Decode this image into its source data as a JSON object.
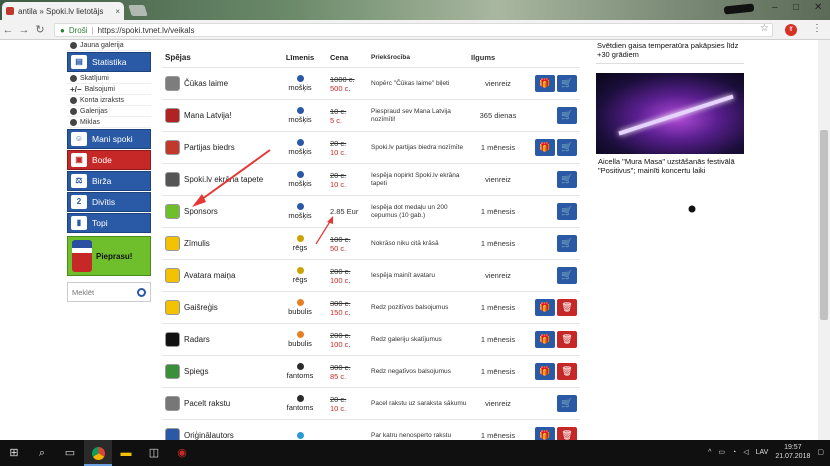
{
  "browser": {
    "tab_title": "antila » Spoki.lv lietotājs",
    "close_glyph": "×",
    "secure_label": "Droši",
    "url": "https://spoki.tvnet.lv/veikals",
    "ext_badge": "ff"
  },
  "sidebar": {
    "sub_items": [
      "Jauna galerija"
    ],
    "statistika": "Statistika",
    "sub_items2": [
      "Skatījumi",
      "Balsojumi",
      "Konta izraksts",
      "Galerijas",
      "Miklas"
    ],
    "mani_spoki": "Mani spoki",
    "bode": "Bode",
    "birza": "Birža",
    "divitis": "Divītis",
    "topi": "Topi",
    "pieprasu": "Pieprasu!",
    "search_placeholder": "Meklēt"
  },
  "table": {
    "headers": {
      "name": "Spējas",
      "level": "Līmenis",
      "price": "Cena",
      "desc": "Priekšrocība",
      "dur": "Ilgums"
    },
    "rows": [
      {
        "name": "Čūkas laime",
        "level": "mošķis",
        "old": "1000 c.",
        "new": "500 c.",
        "desc": "Nopērc \"Čūkas laime\" biļeti",
        "dur": "vienreiz",
        "gift": true,
        "trash": false,
        "icon_color": "#7d7d7d",
        "level_color": "#2a5aa6"
      },
      {
        "name": "Mana Latvija!",
        "level": "mošķis",
        "old": "10 c.",
        "new": "5 c.",
        "desc": "Piespraud sev Mana Latvija nozīmīti!",
        "dur": "365 dienas",
        "gift": false,
        "trash": false,
        "icon_color": "#b22222",
        "level_color": "#2a5aa6"
      },
      {
        "name": "Partijas biedrs",
        "level": "mošķis",
        "old": "20 c.",
        "new": "10 c.",
        "desc": "Spoki.lv partijas biedra nozīmīte",
        "dur": "1 mēnesis",
        "gift": true,
        "trash": false,
        "icon_color": "#c0392b",
        "level_color": "#2a5aa6"
      },
      {
        "name": "Spoki.lv ekrāna tapete",
        "level": "mošķis",
        "old": "20 c.",
        "new": "10 c.",
        "desc": "Iespēja nopirkt Spoki.lv ekrāna tapeti",
        "dur": "vienreiz",
        "gift": false,
        "trash": false,
        "icon_color": "#555",
        "level_color": "#2a5aa6"
      },
      {
        "name": "Sponsors",
        "level": "mošķis",
        "old": "",
        "new": "",
        "cur": "2.85 Eur",
        "desc": "Iespēja dot medaļu un 200 cepumus (10 gab.)",
        "dur": "1 mēnesis",
        "gift": false,
        "trash": false,
        "icon_color": "#6fbe2c",
        "level_color": "#2a5aa6"
      },
      {
        "name": "Zīmulis",
        "level": "rēgs",
        "old": "100 c.",
        "new": "50 c.",
        "desc": "Nokrāso niku citā krāsā",
        "dur": "1 mēnesis",
        "gift": false,
        "trash": false,
        "icon_color": "#f2c200",
        "level_color": "#c9a400"
      },
      {
        "name": "Avatara maiņa",
        "level": "rēgs",
        "old": "200 c.",
        "new": "100 c.",
        "desc": "Iespēja mainīt avataru",
        "dur": "vienreiz",
        "gift": false,
        "trash": false,
        "icon_color": "#f2c200",
        "level_color": "#c9a400"
      },
      {
        "name": "Gaišreģis",
        "level": "bubulis",
        "old": "300 c.",
        "new": "150 c.",
        "desc": "Redz pozitīvos balsojumus",
        "dur": "1 mēnesis",
        "gift": true,
        "trash": true,
        "icon_color": "#f2c200",
        "level_color": "#e67e22"
      },
      {
        "name": "Radars",
        "level": "bubulis",
        "old": "200 c.",
        "new": "100 c.",
        "desc": "Redz galeriju skatījumus",
        "dur": "1 mēnesis",
        "gift": true,
        "trash": true,
        "icon_color": "#111",
        "level_color": "#e67e22"
      },
      {
        "name": "Spiegs",
        "level": "fantoms",
        "old": "300 c.",
        "new": "85 c.",
        "desc": "Redz negatīvos balsojumus",
        "dur": "1 mēnesis",
        "gift": true,
        "trash": true,
        "icon_color": "#3a8f3a",
        "level_color": "#2b2b2b"
      },
      {
        "name": "Pacelt rakstu",
        "level": "fantoms",
        "old": "20 c.",
        "new": "10 c.",
        "desc": "Pacel rakstu uz saraksta sākumu",
        "dur": "vienreiz",
        "gift": false,
        "trash": false,
        "icon_color": "#777",
        "level_color": "#2b2b2b"
      },
      {
        "name": "Oriģinālautors",
        "level": "",
        "old": "",
        "new": "",
        "desc": "Par katru nenosperto rakstu",
        "dur": "1 mēnesis",
        "gift": true,
        "trash": true,
        "icon_color": "#2a5aa6",
        "level_color": "#2a9ad6"
      }
    ]
  },
  "right": {
    "news1": "Svētdien gaisa temperatūra pakāpsies līdz +30 grādiem",
    "news2": "Aicella \"Mura Masa\" uzstāšanās festivālā \"Positivus\"; mainīti koncertu laiki"
  },
  "taskbar": {
    "lang": "LAV",
    "time": "19:57",
    "date": "21.07.2018"
  },
  "colors": {
    "accent": "#2a5aa6",
    "danger": "#c62828",
    "arrow": "#e53935"
  }
}
